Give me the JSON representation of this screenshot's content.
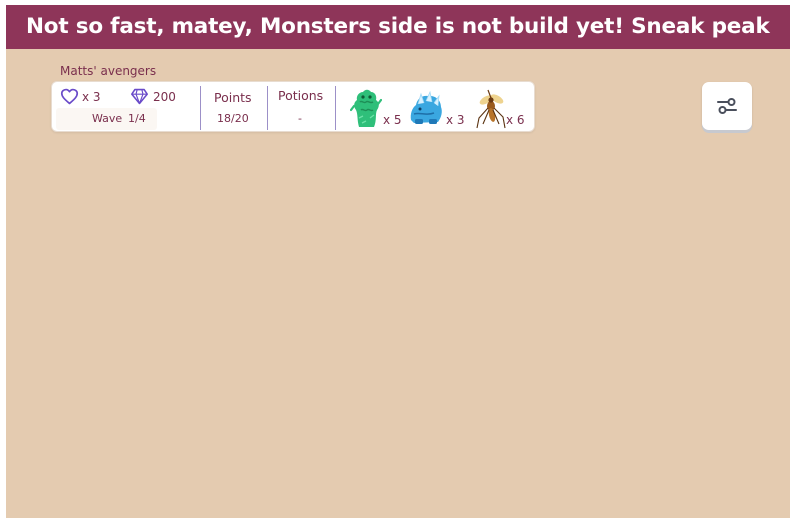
{
  "banner": {
    "text": "Not so fast, matey, Monsters side is not build yet! Sneak peak"
  },
  "team": {
    "name": "Matts' avengers"
  },
  "hud": {
    "lives": "x 3",
    "gems": "200",
    "wave_label": "Wave",
    "wave_value": "1/4",
    "points_label": "Points",
    "points_value": "18/20",
    "potions_label": "Potions",
    "potions_value": "-",
    "monsters": [
      {
        "icon": "green-slime-monster-icon",
        "count": "x 5"
      },
      {
        "icon": "ice-beast-monster-icon",
        "count": "x 3"
      },
      {
        "icon": "mosquito-monster-icon",
        "count": "x 6"
      }
    ]
  },
  "icons": {
    "lives": "heart-outline-icon",
    "gems": "diamond-icon",
    "settings": "sliders-icon"
  },
  "colors": {
    "banner_bg": "#8e3559",
    "background": "#e4cbb0",
    "text_accent": "#7a2f4d",
    "icon_purple": "#6a4bc9",
    "separator": "#9c90c8"
  }
}
